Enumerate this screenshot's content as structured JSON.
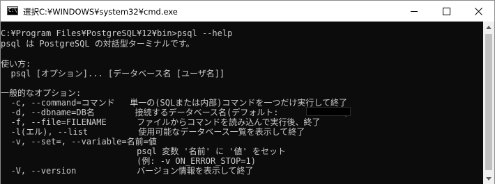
{
  "window": {
    "title_prefix": "選択",
    "title_path": "C:¥WINDOWS¥system32¥cmd.exe",
    "icon": "cmd-icon",
    "app_icon_prompt": "C:\\",
    "controls": {
      "minimize": "minimize-icon",
      "maximize": "maximize-icon",
      "close": "close-icon"
    }
  },
  "console": {
    "lines": [
      "C:¥Program Files¥PostgreSQL¥12¥bin>psql --help",
      "psql は PostgreSQL の対話型ターミナルです。",
      "",
      "使い方:",
      "  psql [オプション]... [データベース名 [ユーザ名]]",
      "",
      "一般的なオプション:",
      "  -c, --command=コマンド   単一の(SQLまたは内部)コマンドを一つだけ実行して終了",
      "  -d, --dbname=DB名        接続するデータベース名(デフォルト:             )",
      "  -f, --file=FILENAME      ファイルからコマンドを読み込んで実行後、終了",
      "  -l(エル), --list          使用可能なデータベース一覧を表示して終了",
      "  -v, --set=, --variable=名前=値",
      "                           psql 変数 '名前' に '値' をセット",
      "                           (例: -v ON_ERROR_STOP=1)",
      "  -V, --version            バージョン情報を表示して終了"
    ],
    "colors": {
      "background": "#0c0c0c",
      "text": "#cccccc"
    }
  },
  "scrollbar": {
    "up": "scroll-up-arrow-icon",
    "down": "scroll-down-arrow-icon"
  }
}
